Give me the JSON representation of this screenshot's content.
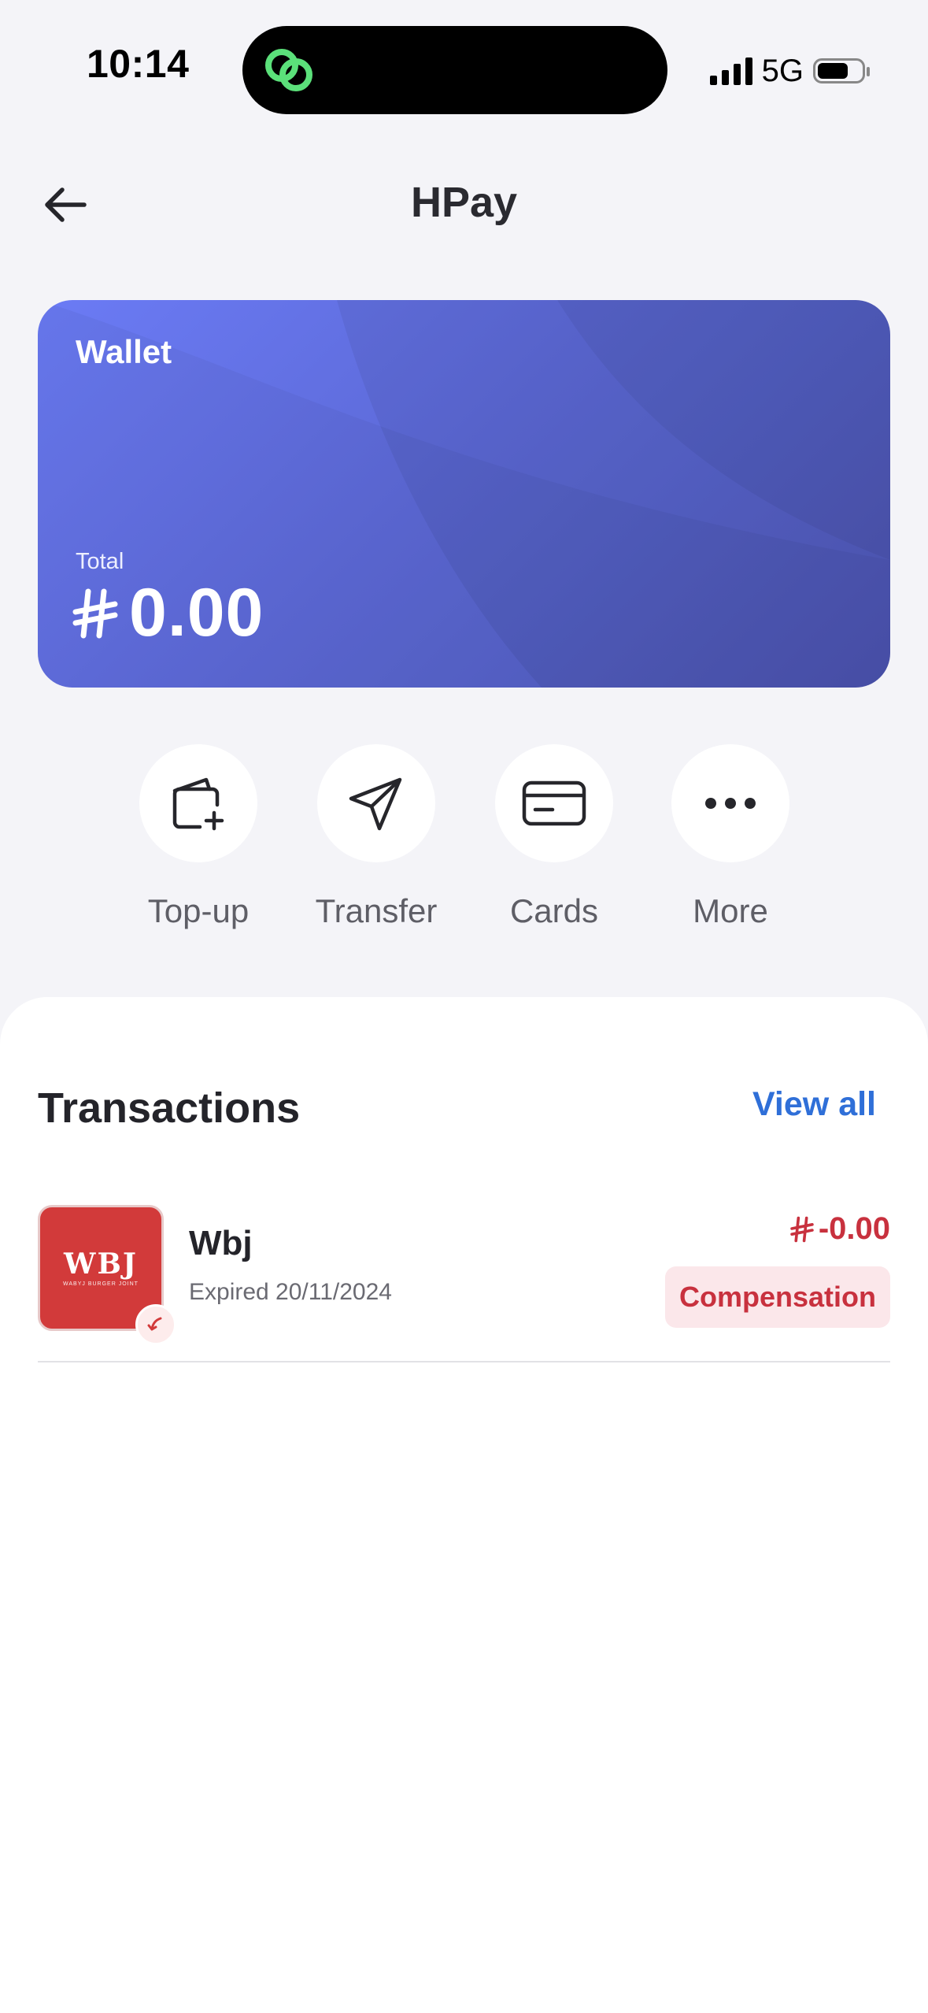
{
  "status_bar": {
    "time": "10:14",
    "network": "5G",
    "battery_level": 0.7
  },
  "header": {
    "title": "HPay",
    "back_icon": "arrow-left-icon"
  },
  "wallet": {
    "label": "Wallet",
    "total_label": "Total",
    "currency_icon": "currency-icon",
    "total_value": "0.00"
  },
  "actions": [
    {
      "label": "Top-up",
      "icon": "wallet-add-icon"
    },
    {
      "label": "Transfer",
      "icon": "send-icon"
    },
    {
      "label": "Cards",
      "icon": "card-icon"
    },
    {
      "label": "More",
      "icon": "more-icon"
    }
  ],
  "transactions": {
    "title": "Transactions",
    "view_all": "View all",
    "items": [
      {
        "name": "Wbj",
        "date": "Expired 20/11/2024",
        "amount": "-0.00",
        "tag": "Compensation",
        "logo_text": "WBJ",
        "logo_subtext": "WABYJ BURGER JOINT"
      }
    ]
  },
  "colors": {
    "background": "#F4F4F8",
    "card_gradient_start": "#6B7BF5",
    "card_gradient_end": "#4E57B6",
    "link": "#2F6FD8",
    "negative": "#C8313E",
    "tag_bg": "#FBE7EA",
    "island_icon": "#5BE07A"
  }
}
